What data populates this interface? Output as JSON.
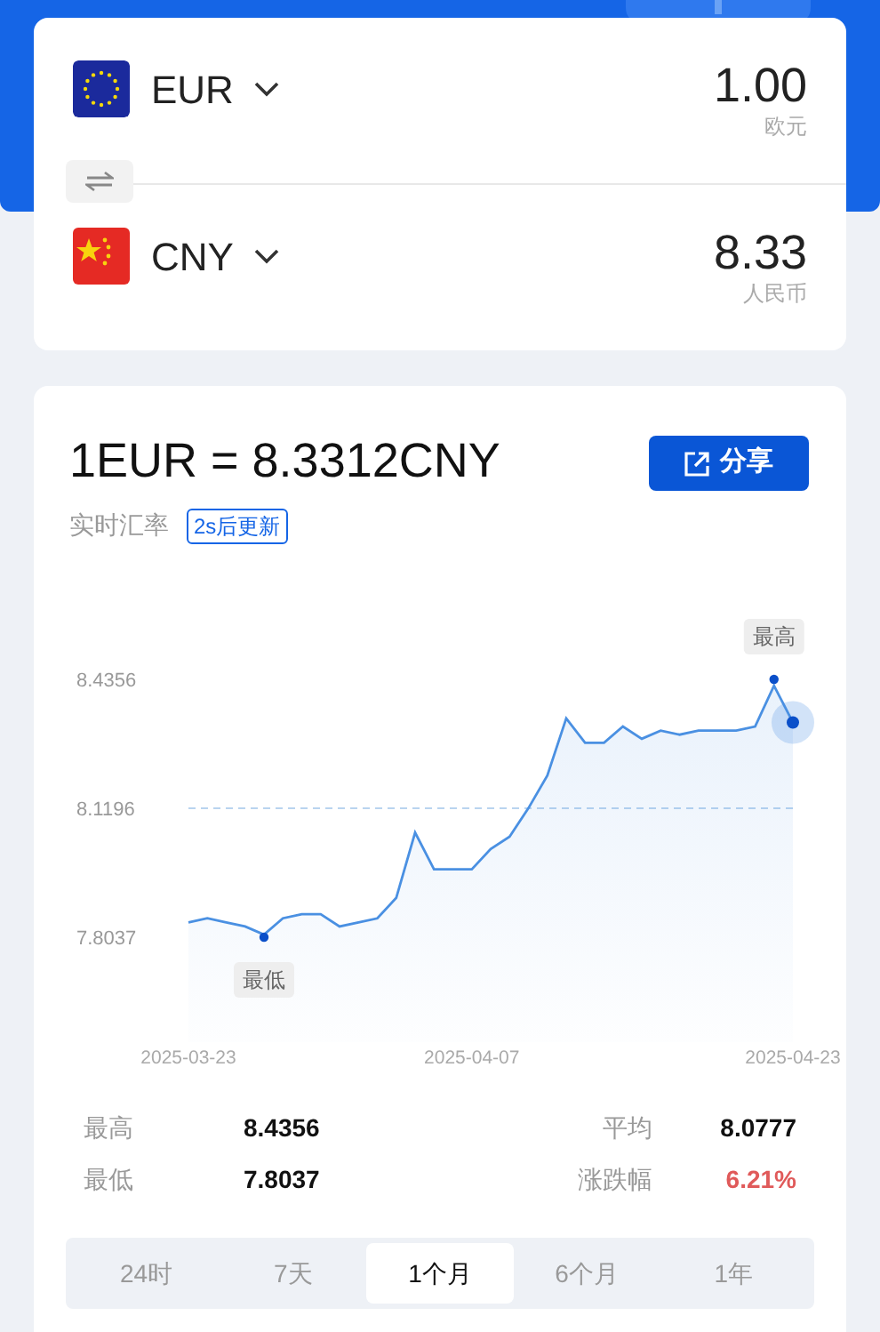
{
  "converter": {
    "rows": [
      {
        "code": "EUR",
        "kind": "eu",
        "amount": "1.00",
        "name": "欧元"
      },
      {
        "code": "CNY",
        "kind": "cn",
        "amount": "8.33",
        "name": "人民币"
      }
    ]
  },
  "rate": {
    "title": "1EUR = 8.3312CNY",
    "share": "分享",
    "label": "实时汇率",
    "badge": "2s后更新"
  },
  "chart": {
    "chart_data": {
      "type": "area",
      "categories": [
        "2025-03-23",
        null,
        null,
        null,
        null,
        null,
        null,
        null,
        null,
        null,
        null,
        null,
        null,
        null,
        null,
        "2025-04-07",
        null,
        null,
        null,
        null,
        null,
        null,
        null,
        null,
        null,
        null,
        null,
        null,
        null,
        null,
        null,
        null,
        "2025-04-23"
      ],
      "series": [
        {
          "color": "#4a90e2",
          "values": [
            7.84,
            7.85,
            7.84,
            7.83,
            7.81,
            7.85,
            7.86,
            7.86,
            7.83,
            7.84,
            7.85,
            7.9,
            8.06,
            7.97,
            7.97,
            7.97,
            8.02,
            8.05,
            8.12,
            8.2,
            8.34,
            8.28,
            8.28,
            8.32,
            8.29,
            8.31,
            8.3,
            8.31,
            8.31,
            8.31,
            8.32,
            8.42,
            8.33
          ]
        }
      ],
      "yticks": [
        7.8037,
        8.1196,
        8.4356
      ],
      "ylim": [
        7.8037,
        8.4356
      ],
      "ref_lines": [
        {
          "axis": "y",
          "value": 8.1196
        }
      ],
      "annotations": [
        {
          "text": "最高",
          "y": 8.4356
        },
        {
          "text": "最低",
          "y": 7.8037
        }
      ]
    }
  },
  "stats": [
    {
      "label": "最高",
      "value": "8.4356",
      "kind": "plain"
    },
    {
      "label": "平均",
      "value": "8.0777",
      "kind": "plain"
    },
    {
      "label": "最低",
      "value": "7.8037",
      "kind": "plain"
    },
    {
      "label": "涨跌幅",
      "value": "6.21%",
      "kind": "rise"
    }
  ],
  "periods": [
    {
      "label": "24时",
      "selected": false
    },
    {
      "label": "7天",
      "selected": false
    },
    {
      "label": "1个月",
      "selected": true
    },
    {
      "label": "6个月",
      "selected": false
    },
    {
      "label": "1年",
      "selected": false
    }
  ]
}
